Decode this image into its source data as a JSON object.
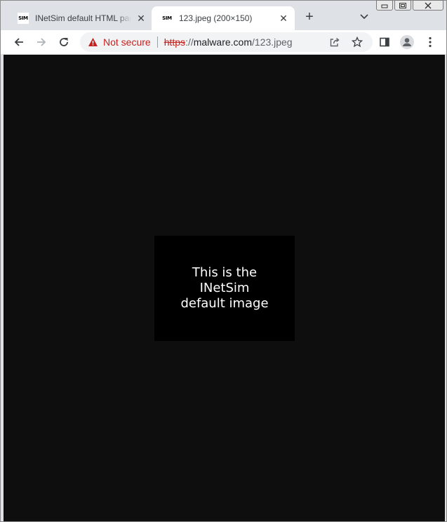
{
  "tabs": [
    {
      "favicon": "SIM",
      "title": "INetSim default HTML page",
      "close": "✕",
      "active": false
    },
    {
      "favicon": "SIM",
      "title": "123.jpeg (200×150)",
      "close": "✕",
      "active": true
    }
  ],
  "new_tab": "+",
  "toolbar": {
    "security_label": "Not secure",
    "url_scheme": "https",
    "url_sep": "://",
    "url_host": "malware.com",
    "url_path": "/123.jpeg"
  },
  "image": {
    "text": "This is the\nINetSim\ndefault image"
  },
  "colors": {
    "tabstrip": "#dee1e6",
    "toolbar": "#ffffff",
    "page_bg": "#0e0e0e",
    "image_bg": "#000000",
    "warning": "#c5221f"
  }
}
